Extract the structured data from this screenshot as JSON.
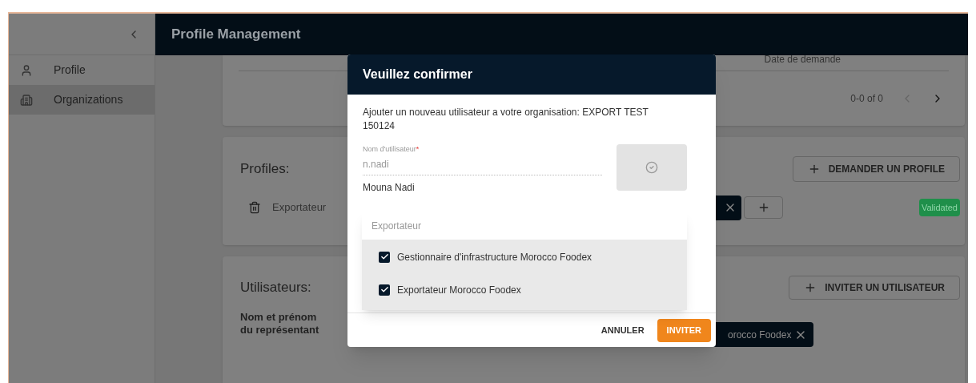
{
  "sidebar": {
    "items": [
      {
        "label": "Profile",
        "selected": false
      },
      {
        "label": "Organizations",
        "selected": true
      }
    ]
  },
  "header": {
    "title": "Profile Management"
  },
  "table": {
    "column": "Date de demande",
    "pagination": "0-0 of 0"
  },
  "profiles": {
    "title": "Profiles:",
    "request_button": "DEMANDER UN PROFILE",
    "rows": [
      {
        "name": "Exportateur",
        "status": "Validated"
      }
    ]
  },
  "users": {
    "title": "Utilisateurs:",
    "invite_button": "INVITER UN UTILISATEUR",
    "column": "Nom et prénom du représentant",
    "chip": "orocco Foodex"
  },
  "dialog": {
    "title": "Veuillez confirmer",
    "message": "Ajouter un nouveau utilisateur a votre organisation: EXPORT TEST 150124",
    "field": {
      "label": "Nom d'utilisateur",
      "required_mark": "*",
      "value": "n.nadi",
      "disabled": true
    },
    "helper": "Mouna Nadi",
    "dropdown": {
      "placeholder": "Exportateur",
      "options": [
        {
          "label": "Gestionnaire d'infrastructure Morocco Foodex",
          "checked": true
        },
        {
          "label": "Exportateur Morocco Foodex",
          "checked": true
        }
      ]
    },
    "cancel_button": "ANNULER",
    "confirm_button": "INVITER"
  }
}
